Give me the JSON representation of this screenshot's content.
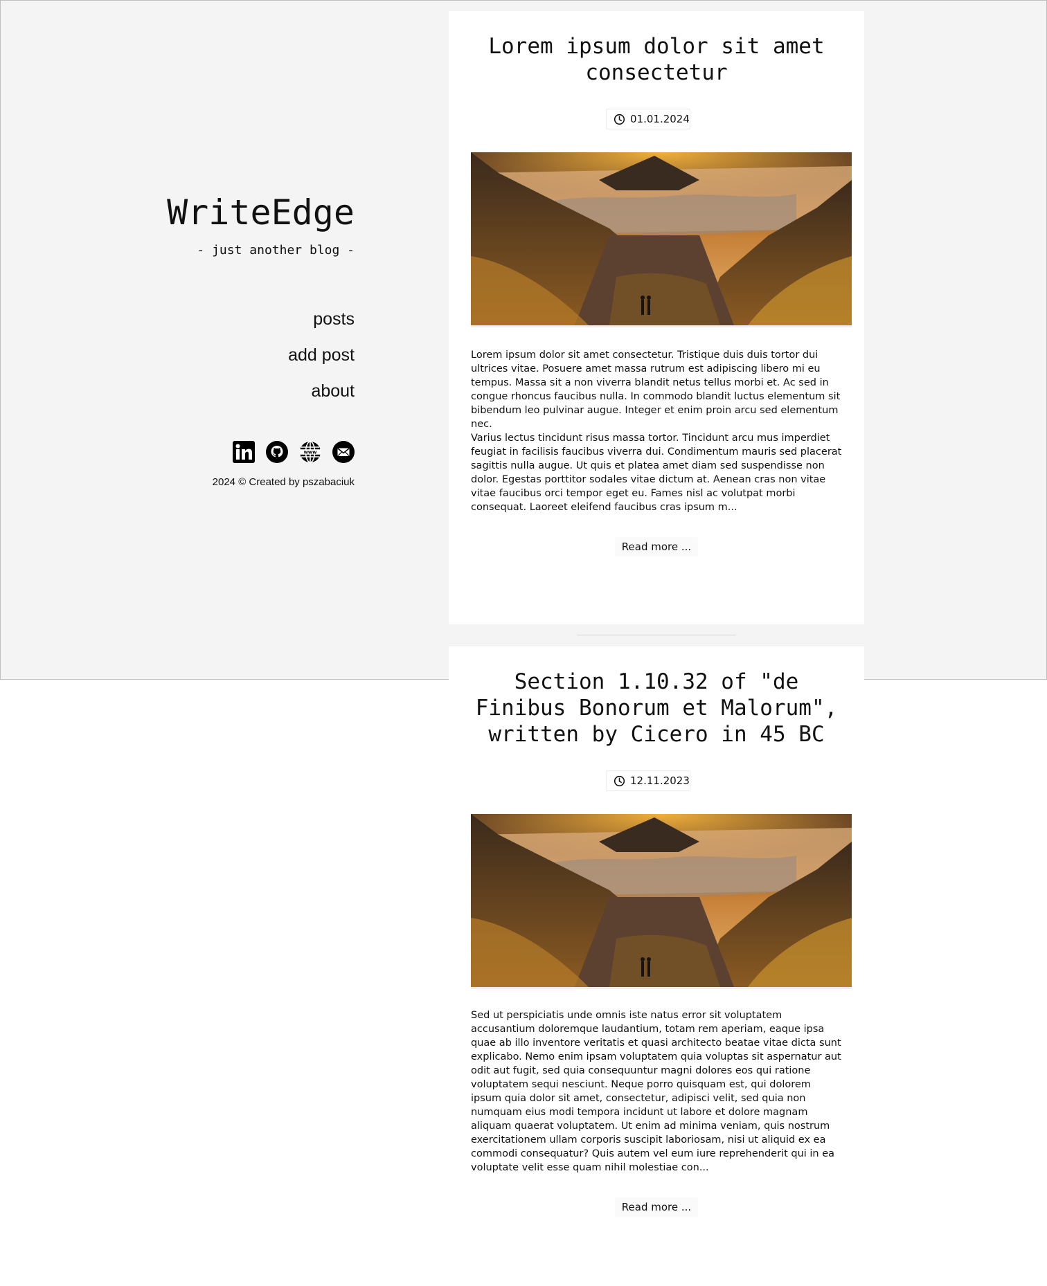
{
  "sidebar": {
    "title": "WriteEdge",
    "subtitle": "- just another blog -",
    "nav": [
      {
        "label": "posts"
      },
      {
        "label": "add post"
      },
      {
        "label": "about"
      }
    ],
    "socials": [
      {
        "icon": "linkedin-icon"
      },
      {
        "icon": "github-icon"
      },
      {
        "icon": "globe-icon"
      },
      {
        "icon": "mail-icon"
      }
    ],
    "copyright": "2024 © Created by pszabaciuk"
  },
  "posts": [
    {
      "title": "Lorem ipsum dolor sit amet consectetur",
      "date": "01.01.2024",
      "body": [
        "Lorem ipsum dolor sit amet consectetur. Tristique duis duis tortor dui ultrices vitae. Posuere amet massa rutrum est adipiscing libero mi eu tempus. Massa sit a non viverra blandit netus tellus morbi et. Ac sed in congue rhoncus faucibus nulla. In commodo blandit luctus elementum sit bibendum leo pulvinar augue. Integer et enim proin arcu sed elementum nec.",
        "Varius lectus tincidunt risus massa tortor. Tincidunt arcu mus imperdiet feugiat in facilisis faucibus viverra dui. Condimentum mauris sed placerat sagittis nulla augue. Ut quis et platea amet diam sed suspendisse non dolor. Egestas porttitor sodales vitae dictum at. Aenean cras non vitae vitae faucibus orci tempor eget eu. Fames nisl ac volutpat morbi consequat. Laoreet eleifend faucibus cras ipsum m..."
      ],
      "read_more": "Read more ..."
    },
    {
      "title": "Section 1.10.32 of \"de Finibus Bonorum et Malorum\", written by Cicero in 45 BC",
      "date": "12.11.2023",
      "body": [
        "Sed ut perspiciatis unde omnis iste natus error sit voluptatem accusantium doloremque laudantium, totam rem aperiam, eaque ipsa quae ab illo inventore veritatis et quasi architecto beatae vitae dicta sunt explicabo. Nemo enim ipsam voluptatem quia voluptas sit aspernatur aut odit aut fugit, sed quia consequuntur magni dolores eos qui ratione voluptatem sequi nesciunt. Neque porro quisquam est, qui dolorem ipsum quia dolor sit amet, consectetur, adipisci velit, sed quia non numquam eius modi tempora incidunt ut labore et dolore magnam aliquam quaerat voluptatem. Ut enim ad minima veniam, quis nostrum exercitationem ullam corporis suscipit laboriosam, nisi ut aliquid ex ea commodi consequatur? Quis autem vel eum iure reprehenderit qui in ea voluptate velit esse quam nihil molestiae con..."
      ],
      "read_more": "Read more ..."
    }
  ]
}
